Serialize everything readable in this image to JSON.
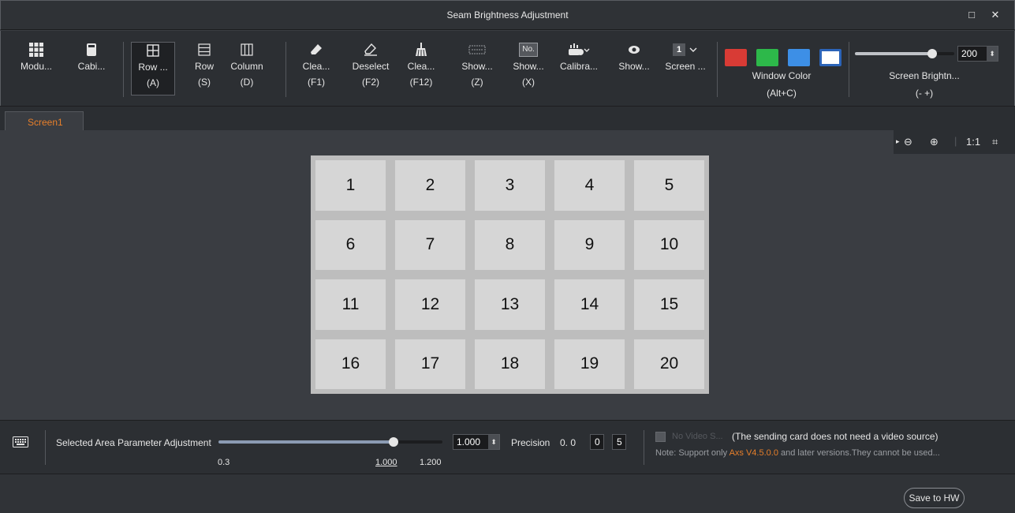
{
  "window": {
    "title": "Seam Brightness Adjustment",
    "maximize_glyph": "□",
    "close_glyph": "✕"
  },
  "toolbar": {
    "module": {
      "label": "Modu...",
      "icon": "module-grid-icon"
    },
    "cabinet": {
      "label": "Cabi...",
      "icon": "cabinet-icon"
    },
    "row_col": {
      "label": "Row ...",
      "key": "(A)",
      "icon": "row-column-icon"
    },
    "row": {
      "label": "Row",
      "key": "(S)",
      "icon": "row-icon"
    },
    "column": {
      "label": "Column",
      "key": "(D)",
      "icon": "column-icon"
    },
    "clear": {
      "label": "Clea...",
      "key": "(F1)",
      "icon": "eraser-icon"
    },
    "deselect": {
      "label": "Deselect",
      "key": "(F2)",
      "icon": "eraser-icon"
    },
    "clear_all": {
      "label": "Clea...",
      "key": "(F12)",
      "icon": "broom-icon"
    },
    "show_seams": {
      "label": "Show...",
      "key": "(Z)",
      "icon": "seams-icon"
    },
    "show_no": {
      "label": "Show...",
      "key": "(X)",
      "icon": "number-icon",
      "badge": "No."
    },
    "calibrate": {
      "label": "Calibra...",
      "icon": "calibration-icon"
    },
    "show_eye": {
      "label": "Show...",
      "icon": "eye-icon"
    },
    "screen": {
      "label": "Screen ...",
      "badge": "1",
      "icon": "screen-select-icon"
    },
    "window_color": {
      "label": "Window Color",
      "key": "(Alt+C)",
      "colors": [
        "#d83b35",
        "#2db84a",
        "#3d8fe6",
        "#ffffff"
      ]
    },
    "screen_brightness": {
      "label": "Screen Brightn...",
      "key": "(-  +)",
      "value": "200",
      "level": 0.78
    }
  },
  "tabs": [
    {
      "label": "Screen1",
      "active": true
    }
  ],
  "zoom": {
    "zoom_out": "⊖",
    "zoom_in": "⊕",
    "ratio": "1:1",
    "fit": "⌗"
  },
  "cells": [
    "1",
    "2",
    "3",
    "4",
    "5",
    "6",
    "7",
    "8",
    "9",
    "10",
    "11",
    "12",
    "13",
    "14",
    "15",
    "16",
    "17",
    "18",
    "19",
    "20"
  ],
  "adjust": {
    "label": "Selected Area Parameter Adjustment",
    "min": "0.3",
    "mid": "1.000",
    "max": "1.200",
    "value": "1.000",
    "level": 0.78,
    "precision_label": "Precision",
    "precision_prefix": "0. 0",
    "precision_d1": "0",
    "precision_d2": "5"
  },
  "video": {
    "checkbox_label": "No Video S...",
    "note_main": "(The sending card does not need a video source)",
    "note_prefix": "Note: Support only ",
    "note_highlight": "Axs V4.5.0.0",
    "note_suffix": " and later versions.They cannot be used..."
  },
  "footer": {
    "save": "Save to HW"
  }
}
